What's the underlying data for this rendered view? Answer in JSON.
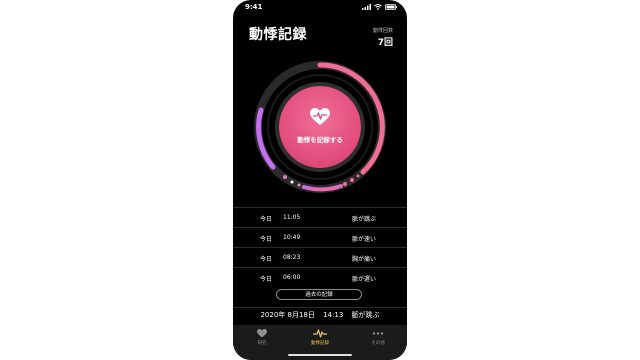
{
  "status": {
    "time": "9:41"
  },
  "header": {
    "title": "動悸記録",
    "count_label": "動悸回数",
    "count_value": "7回"
  },
  "record_button": {
    "label": "動悸を記録する"
  },
  "records": [
    {
      "day": "今日",
      "time": "11:05",
      "note": "脈が跳ぶ"
    },
    {
      "day": "今日",
      "time": "10:49",
      "note": "脈が速い"
    },
    {
      "day": "今日",
      "time": "08:23",
      "note": "胸が痛い"
    },
    {
      "day": "今日",
      "time": "06:00",
      "note": "脈が遅い"
    }
  ],
  "past_button": {
    "label": "過去の記録"
  },
  "current_datetime": {
    "date": "2020年 8月18日",
    "time": "14:13",
    "note": "脈が跳ぶ"
  },
  "tabs": [
    {
      "label": "研究",
      "icon": "heart-icon",
      "active": false
    },
    {
      "label": "動悸記録",
      "icon": "pulse-icon",
      "active": true
    },
    {
      "label": "その他",
      "icon": "more-icon",
      "active": false
    }
  ],
  "colors": {
    "accent": "#e24d7d",
    "ring_pink": "#f26d95",
    "ring_purple": "#c46ef0",
    "active_tab": "#f2c14e",
    "inactive_tab": "#8e8e8e"
  }
}
